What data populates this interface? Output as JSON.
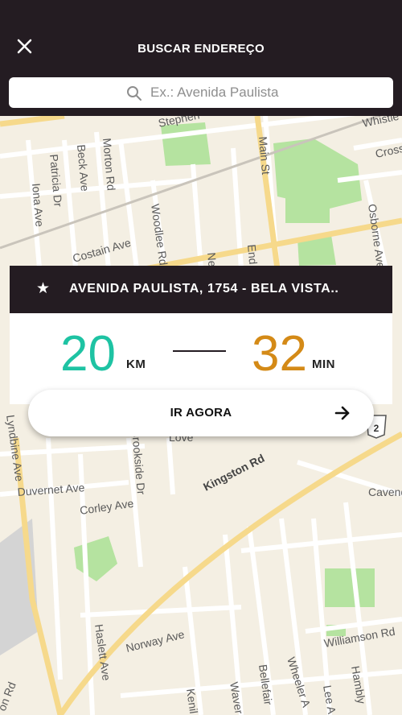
{
  "header": {
    "title": "BUSCAR ENDEREÇO",
    "close_icon": "close-icon"
  },
  "search": {
    "placeholder": "Ex.: Avenida Paulista",
    "value": ""
  },
  "map": {
    "streets": [
      "Stephen",
      "Whistle",
      "Cross",
      "Main St",
      "Patricia Dr",
      "Beck Ave",
      "Morton Rd",
      "Iona Ave",
      "Woodlee Rd",
      "Costain Ave",
      "Osborne Ave",
      "Ne",
      "End",
      "Love",
      "Brookside Dr",
      "Kingston Rd",
      "Duvernet Ave",
      "Corley Ave",
      "Lyndbine Ave",
      "Cavend",
      "Haslett Ave",
      "Norway Ave",
      "Williamson Rd",
      "Bellefair",
      "Wheeler A",
      "Hambly",
      "Lee A",
      "Kenil",
      "Waver",
      "on Rd"
    ],
    "route_badge": "2"
  },
  "destination": {
    "icon": "star-icon",
    "address": "AVENIDA PAULISTA, 1754 - BELA VISTA..",
    "distance": {
      "value": "20",
      "unit": "KM"
    },
    "time": {
      "value": "32",
      "unit": "MIN"
    }
  },
  "action": {
    "label": "IR AGORA",
    "icon": "arrow-right-icon"
  },
  "colors": {
    "header": "#241c22",
    "distance": "#1ec3a3",
    "time": "#d48a17",
    "map_bg": "#f4efe3",
    "park": "#b5e3a0"
  }
}
